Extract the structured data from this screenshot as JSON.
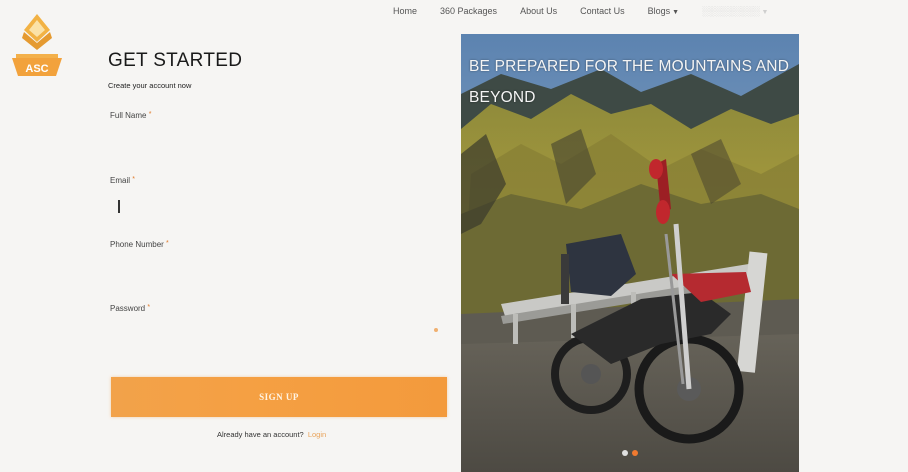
{
  "brand": {
    "logo_text": "ASC",
    "accent": "#f5a043"
  },
  "nav": {
    "items": [
      {
        "label": "Home",
        "faint": false
      },
      {
        "label": "360 Packages",
        "faint": false
      },
      {
        "label": "About Us",
        "faint": false
      },
      {
        "label": "Contact Us",
        "faint": false
      },
      {
        "label": "Blogs",
        "faint": false,
        "dropdown": true
      }
    ]
  },
  "form": {
    "title": "GET STARTED",
    "subtitle": "Create your account now",
    "fields": [
      {
        "label": "Full Name",
        "required": "*"
      },
      {
        "label": "Email",
        "required": "*"
      },
      {
        "label": "Phone Number",
        "required": "*"
      },
      {
        "label": "Password",
        "required": "*"
      }
    ],
    "submit_label": "SIGN UP",
    "login_prompt": "Already have an account?",
    "login_link": "Login"
  },
  "hero": {
    "caption": "BE PREPARED FOR THE MOUNTAINS AND BEYOND"
  }
}
